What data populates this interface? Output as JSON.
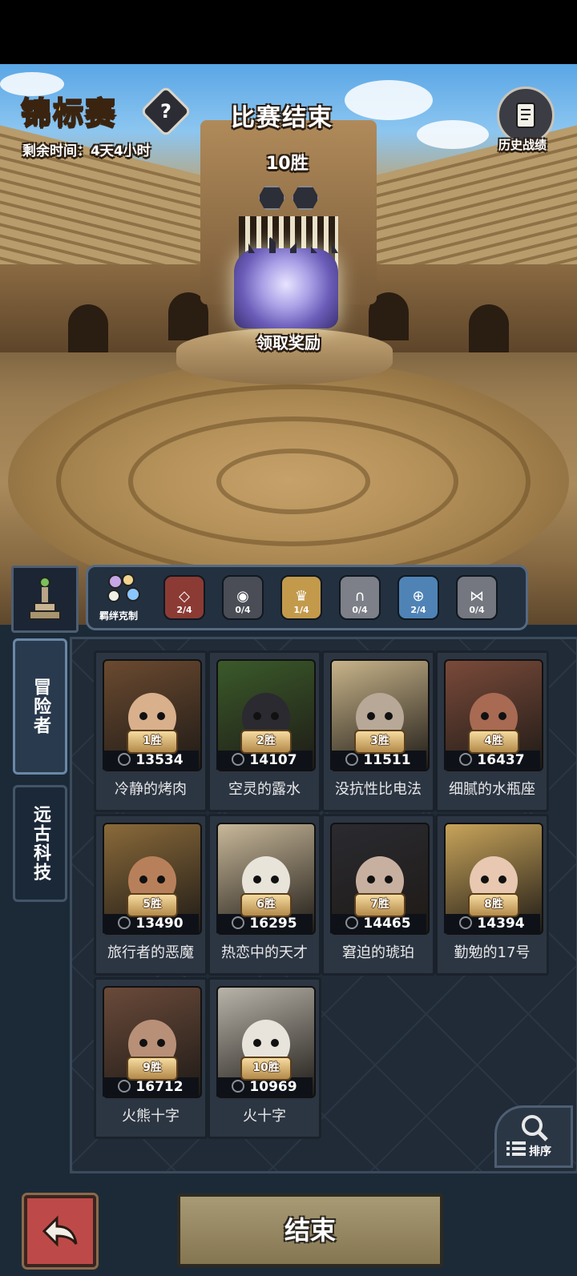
{
  "header": {
    "title": "锦标赛",
    "help_icon": "?",
    "time_remaining": "剩余时间：4天4小时",
    "match_status": "比赛结束",
    "wins": "10胜",
    "claim_reward": "领取奖励",
    "history_label": "历史战绩"
  },
  "bonds": {
    "label": "羁绊克制",
    "items": [
      {
        "count": "2/4",
        "color": "#8b3b34",
        "icon": "diamond-icon"
      },
      {
        "count": "0/4",
        "color": "#4a4d55",
        "icon": "eye-icon"
      },
      {
        "count": "1/4",
        "color": "#c39a4c",
        "icon": "crown-icon"
      },
      {
        "count": "0/4",
        "color": "#7d8088",
        "icon": "arch-icon"
      },
      {
        "count": "2/4",
        "color": "#4f83b6",
        "icon": "shield-icon"
      },
      {
        "count": "0/4",
        "color": "#74777f",
        "icon": "figure-icon"
      }
    ]
  },
  "side_tabs": [
    {
      "label": "冒险者",
      "active": true
    },
    {
      "label": "远古科技",
      "active": false
    }
  ],
  "adventurers": [
    {
      "win": "1胜",
      "power": "13534",
      "name": "冷静的烤肉"
    },
    {
      "win": "2胜",
      "power": "14107",
      "name": "空灵的露水"
    },
    {
      "win": "3胜",
      "power": "11511",
      "name": "没抗性比电法"
    },
    {
      "win": "4胜",
      "power": "16437",
      "name": "细腻的水瓶座"
    },
    {
      "win": "5胜",
      "power": "13490",
      "name": "旅行者的恶魔"
    },
    {
      "win": "6胜",
      "power": "16295",
      "name": "热恋中的天才"
    },
    {
      "win": "7胜",
      "power": "14465",
      "name": "窘迫的琥珀"
    },
    {
      "win": "8胜",
      "power": "14394",
      "name": "勤勉的17号"
    },
    {
      "win": "9胜",
      "power": "16712",
      "name": "火熊十字"
    },
    {
      "win": "10胜",
      "power": "10969",
      "name": "火十字"
    }
  ],
  "sort_label": "排序",
  "end_button": "结束"
}
